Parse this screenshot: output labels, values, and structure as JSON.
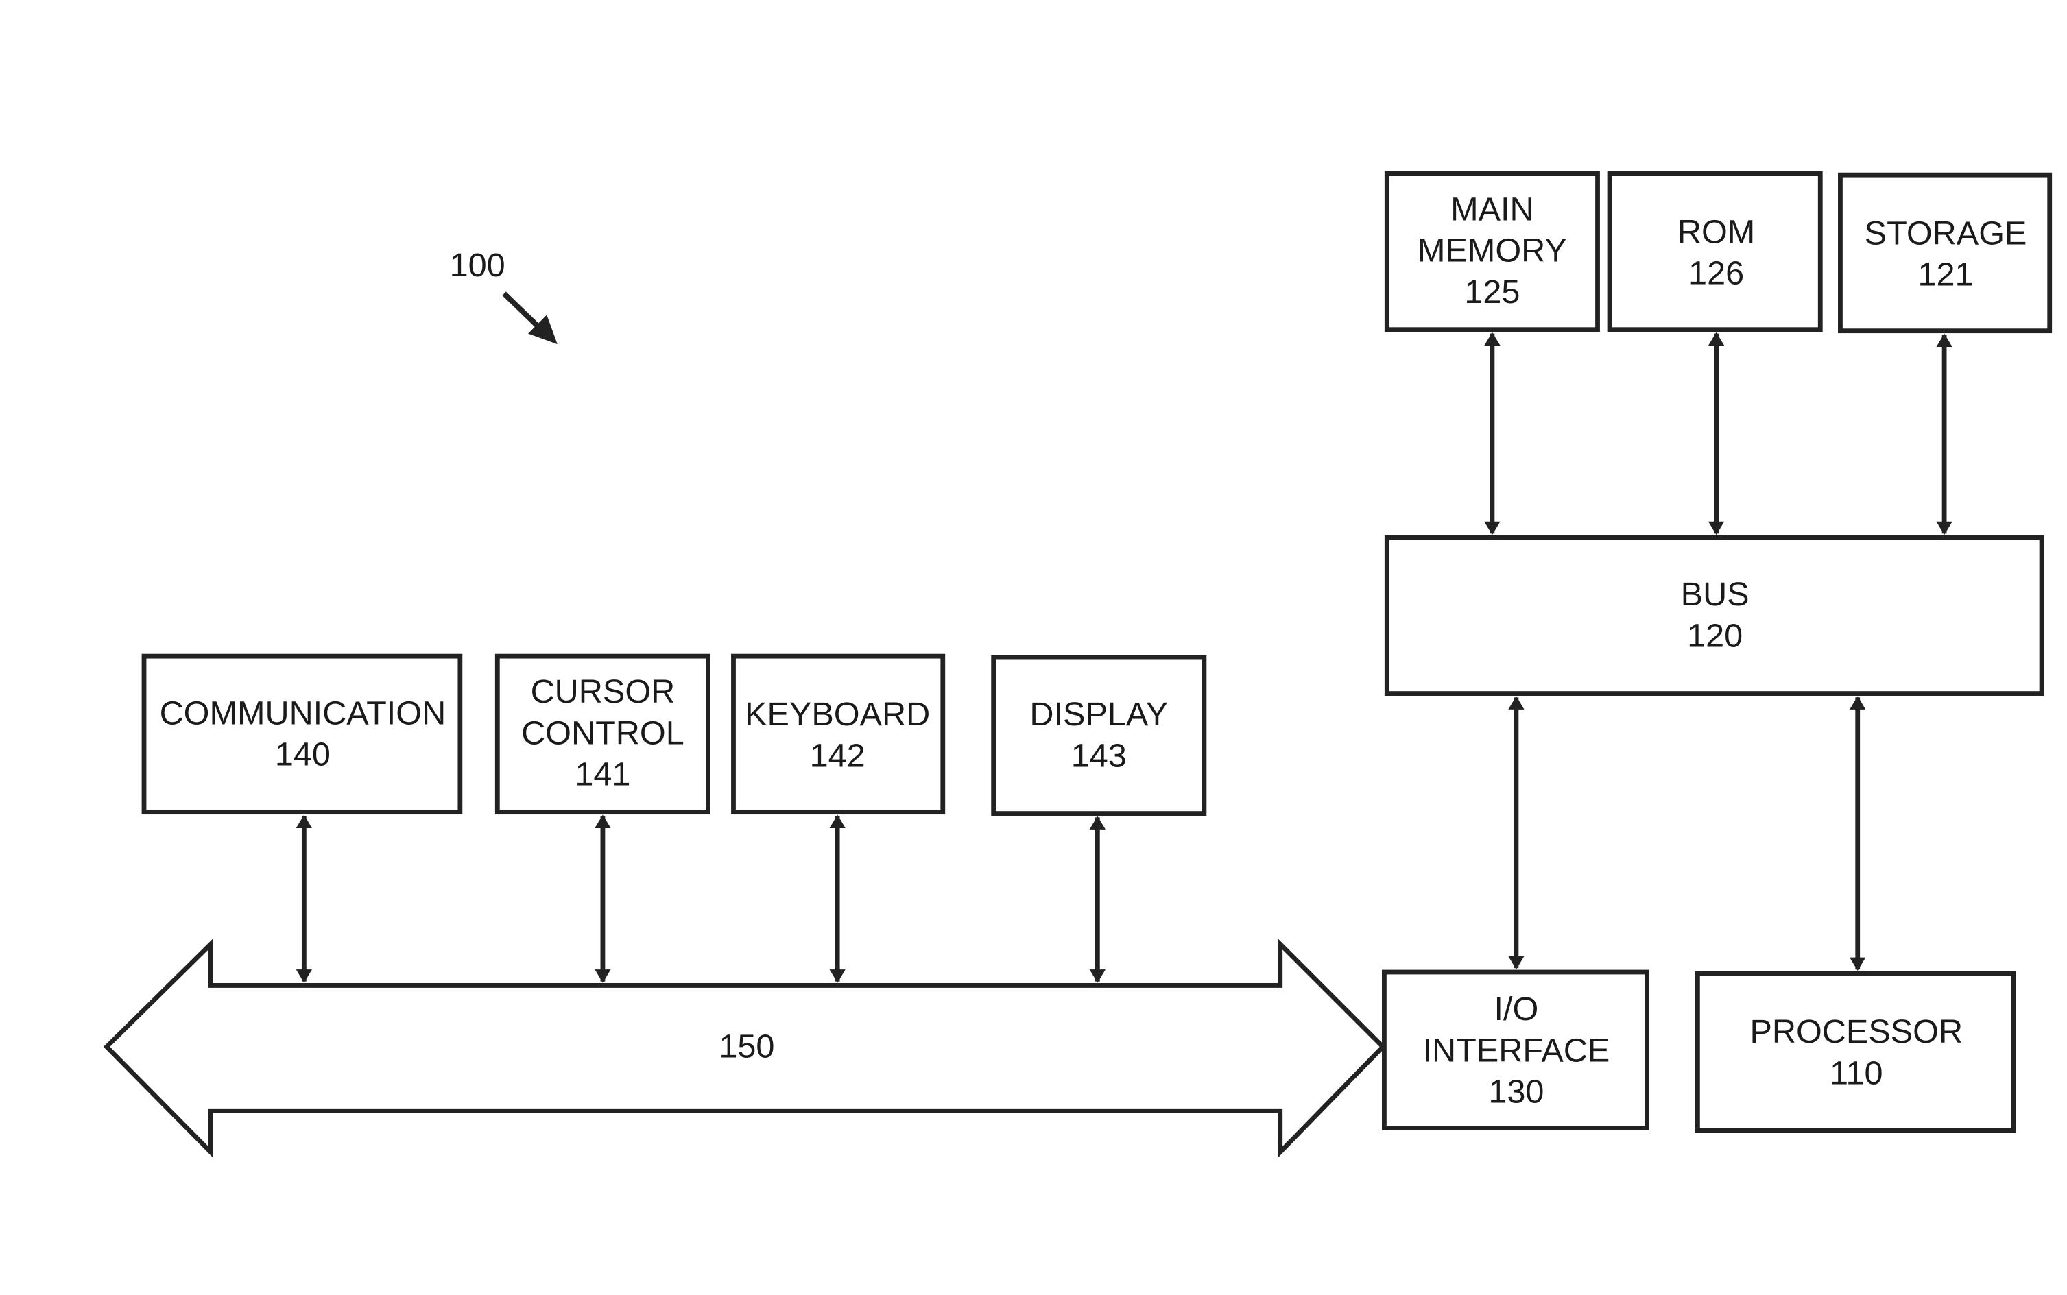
{
  "figure_label": "100",
  "blocks": {
    "main_memory": {
      "lines": [
        "MAIN",
        "MEMORY",
        "125"
      ]
    },
    "rom": {
      "lines": [
        "ROM",
        "126"
      ]
    },
    "storage": {
      "lines": [
        "STORAGE",
        "121"
      ]
    },
    "bus": {
      "lines": [
        "BUS",
        "120"
      ]
    },
    "io_interface": {
      "lines": [
        "I/O",
        "INTERFACE",
        "130"
      ]
    },
    "processor": {
      "lines": [
        "PROCESSOR",
        "110"
      ]
    },
    "communication": {
      "lines": [
        "COMMUNICATION",
        "140"
      ]
    },
    "cursor_control": {
      "lines": [
        "CURSOR",
        "CONTROL",
        "141"
      ]
    },
    "keyboard": {
      "lines": [
        "KEYBOARD",
        "142"
      ]
    },
    "display": {
      "lines": [
        "DISPLAY",
        "143"
      ]
    }
  },
  "io_bus_label": "150",
  "connections": [
    {
      "from": "main_memory",
      "to": "bus",
      "type": "bidirectional"
    },
    {
      "from": "rom",
      "to": "bus",
      "type": "bidirectional"
    },
    {
      "from": "storage",
      "to": "bus",
      "type": "bidirectional"
    },
    {
      "from": "io_interface",
      "to": "bus",
      "type": "bidirectional"
    },
    {
      "from": "processor",
      "to": "bus",
      "type": "bidirectional"
    },
    {
      "from": "communication",
      "to": "io_bus_150",
      "type": "bidirectional"
    },
    {
      "from": "cursor_control",
      "to": "io_bus_150",
      "type": "bidirectional"
    },
    {
      "from": "keyboard",
      "to": "io_bus_150",
      "type": "bidirectional"
    },
    {
      "from": "display",
      "to": "io_bus_150",
      "type": "bidirectional"
    },
    {
      "from": "io_bus_150",
      "to": "io_interface",
      "type": "bidirectional"
    }
  ]
}
